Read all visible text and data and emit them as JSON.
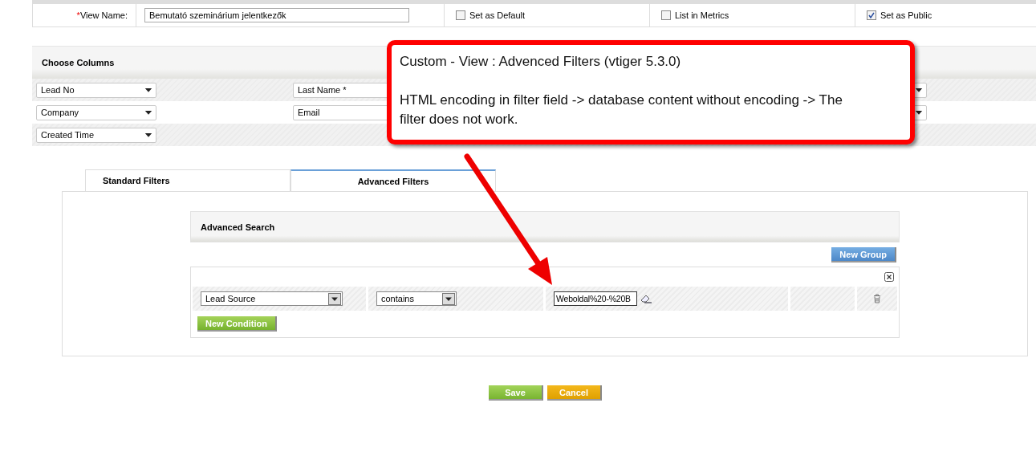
{
  "view_form": {
    "required_mark": "*",
    "label": "View Name:",
    "value": "Bemutató szeminárium jelentkezők",
    "options": [
      {
        "label": "Set as Default",
        "checked": false
      },
      {
        "label": "List in Metrics",
        "checked": false
      },
      {
        "label": "Set as Public",
        "checked": true
      }
    ]
  },
  "choose_columns": {
    "title": "Choose Columns",
    "rows": [
      [
        "Lead No",
        "Last Name *",
        null
      ],
      [
        "Company",
        "Email",
        null
      ],
      [
        "Created Time",
        null,
        null
      ]
    ]
  },
  "tabs": [
    {
      "label": "Standard Filters",
      "selected": false
    },
    {
      "label": "Advanced Filters",
      "selected": true
    }
  ],
  "advanced_search": {
    "title": "Advanced Search",
    "new_group": "New Group",
    "conditions": [
      {
        "field": "Lead Source",
        "operator": "contains",
        "value": "Weboldal%20-%20B"
      }
    ],
    "new_condition": "New Condition"
  },
  "buttons": [
    {
      "label": "Save",
      "kind": "save"
    },
    {
      "label": "Cancel",
      "kind": "cancel"
    }
  ],
  "annotation": {
    "title": "Custom - View : Advenced Filters (vtiger 5.3.0)",
    "body": "HTML encoding in filter field -> database content without encoding -> The filter does not work."
  }
}
